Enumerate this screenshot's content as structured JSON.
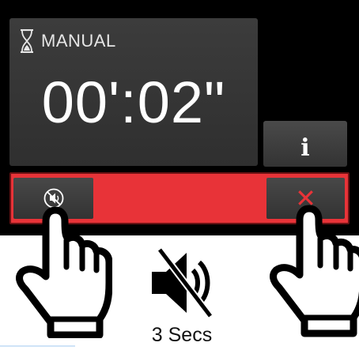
{
  "timer": {
    "mode_label": "MANUAL",
    "time_value": "00':02\"",
    "icon": "hourglass-icon"
  },
  "buttons": {
    "info_label": "i",
    "mute_icon": "mute-icon",
    "close_label": "✕"
  },
  "instruction": {
    "duration_label": "3 Secs",
    "icon": "speaker-muted-icon"
  },
  "colors": {
    "screen_bg": "#000000",
    "panel_bg": "#3a3a3a",
    "accent_red": "#e83338",
    "text_white": "#ffffff"
  }
}
